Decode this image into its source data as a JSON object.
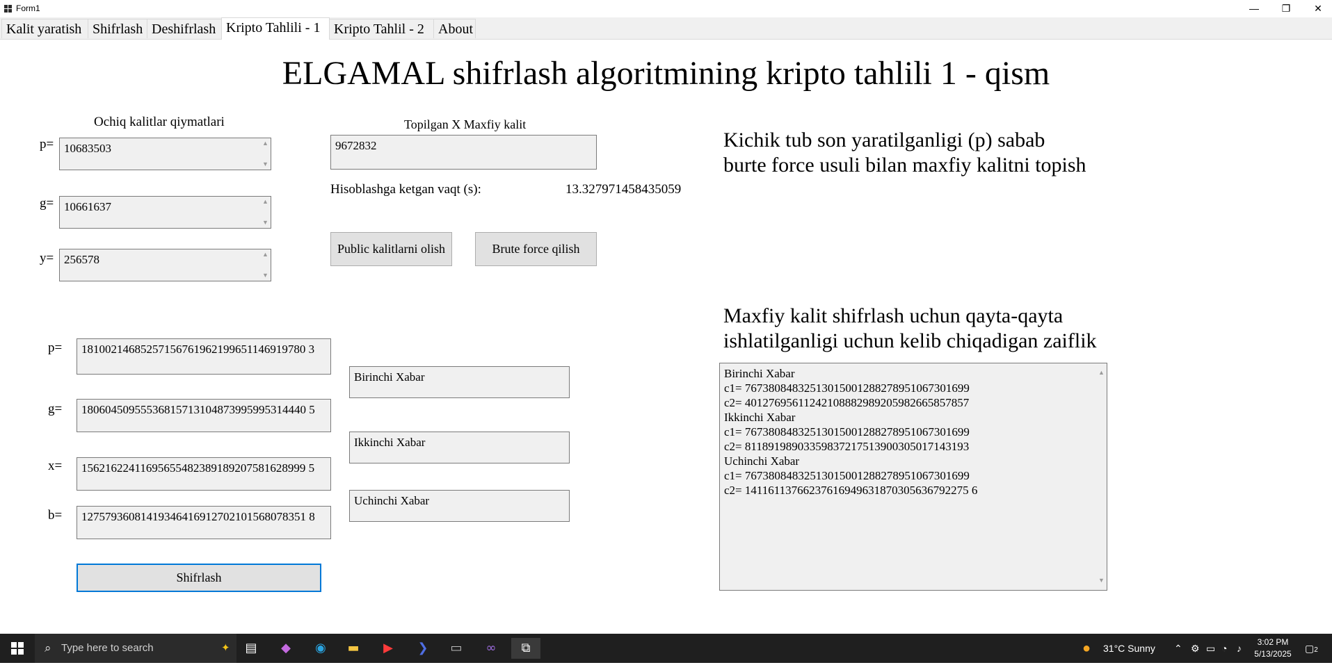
{
  "window": {
    "title": "Form1",
    "minimize_glyph": "—",
    "restore_glyph": "❐",
    "close_glyph": "✕"
  },
  "tabs": [
    {
      "label": "Kalit yaratish"
    },
    {
      "label": "Shifrlash"
    },
    {
      "label": "Deshifrlash"
    },
    {
      "label": "Kripto Tahlili - 1",
      "active": true
    },
    {
      "label": "Kripto Tahlil - 2"
    },
    {
      "label": "About"
    }
  ],
  "heading": "ELGAMAL shifrlash algoritmining kripto tahlili 1 - qism",
  "public_keys": {
    "title": "Ochiq kalitlar qiymatlari",
    "p_label": "p=",
    "p_value": "10683503",
    "g_label": "g=",
    "g_value": "10661637",
    "y_label": "y=",
    "y_value": "256578"
  },
  "secret_found": {
    "title": "Topilgan X Maxfiy kalit",
    "value": "9672832",
    "time_label": "Hisoblashga ketgan vaqt (s):",
    "time_value": "13.327971458435059"
  },
  "buttons": {
    "get_public": "Public kalitlarni olish",
    "brute_force": "Brute force qilish",
    "encrypt": "Shifrlash"
  },
  "note_1": {
    "line1": "Kichik tub son yaratilganligi (p) sabab",
    "line2": "burte force usuli bilan maxfiy kalitni topish"
  },
  "note_2": {
    "line1": "Maxfiy kalit shifrlash uchun qayta-qayta",
    "line2": "ishlatilganligi uchun kelib chiqadigan zaiflik"
  },
  "params": {
    "p_label": "p=",
    "p_value": "18100214685257156761962199651146919780 3",
    "g_label": "g=",
    "g_value": "18060450955536815713104873995995314440 5",
    "x_label": "x=",
    "x_value": "15621622411695655482389189207581628999 5",
    "b_label": "b=",
    "b_value": "12757936081419346416912702101568078351 8"
  },
  "messages": {
    "first": "Birinchi Xabar",
    "second": "Ikkinchi Xabar",
    "third": "Uchinchi Xabar"
  },
  "output_lines": [
    "Birinchi Xabar",
    "c1= 76738084832513015001288278951067301699",
    "c2= 40127695611242108882989205982665857857",
    "Ikkinchi Xabar",
    "c1= 76738084832513015001288278951067301699",
    "c2= 81189198903359837217513900305017143193",
    "Uchinchi Xabar",
    "c1= 76738084832513015001288278951067301699",
    "c2= 14116113766237616949631870305636792275 6"
  ],
  "taskbar": {
    "search_placeholder": "Type here to search",
    "weather": "31°C  Sunny",
    "time": "3:02 PM",
    "date": "5/13/2025",
    "notification_count": "2"
  },
  "colors": {
    "accent": "#0078d7",
    "field_bg": "#f0f0f0",
    "taskbar": "#1f1f1f"
  }
}
